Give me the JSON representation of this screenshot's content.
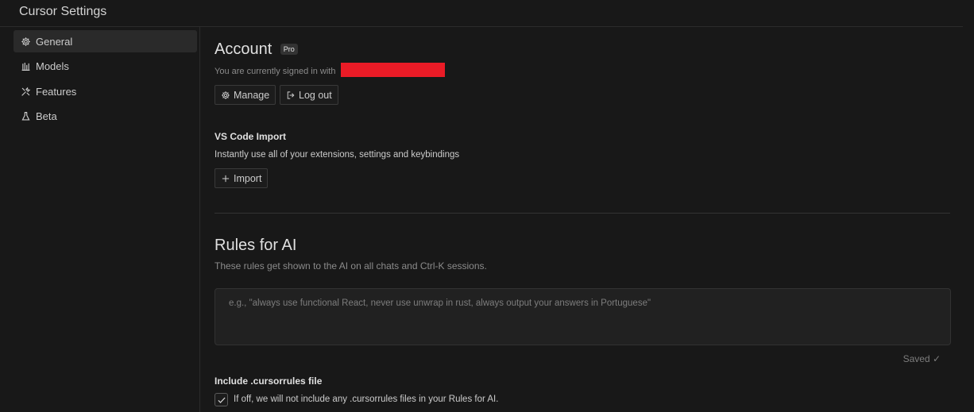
{
  "window": {
    "title": "Cursor Settings"
  },
  "sidebar": {
    "items": [
      {
        "label": "General",
        "icon": "gear-icon",
        "active": true
      },
      {
        "label": "Models",
        "icon": "bar-chart-icon",
        "active": false
      },
      {
        "label": "Features",
        "icon": "tools-icon",
        "active": false
      },
      {
        "label": "Beta",
        "icon": "flask-icon",
        "active": false
      }
    ]
  },
  "account": {
    "title": "Account",
    "badge": "Pro",
    "signed_in_text": "You are currently signed in with",
    "manage_label": "Manage",
    "logout_label": "Log out"
  },
  "vscode_import": {
    "title": "VS Code Import",
    "description": "Instantly use all of your extensions, settings and keybindings",
    "import_label": "Import"
  },
  "rules": {
    "title": "Rules for AI",
    "description": "These rules get shown to the AI on all chats and Ctrl-K sessions.",
    "placeholder": "e.g., \"always use functional React, never use unwrap in rust, always output your answers in Portuguese\"",
    "value": "",
    "status": "Saved ✓"
  },
  "cursorrules": {
    "title": "Include .cursorrules file",
    "description": "If off, we will not include any .cursorrules files in your Rules for AI.",
    "checked": true
  },
  "colors": {
    "background": "#181818",
    "redaction": "#ea1b26",
    "active_nav": "#2a2a2a"
  }
}
